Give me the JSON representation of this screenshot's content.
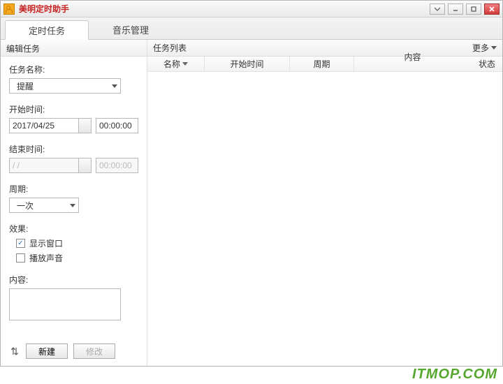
{
  "titlebar": {
    "title": "美明定时助手"
  },
  "tabs": {
    "timer": "定时任务",
    "music": "音乐管理"
  },
  "left": {
    "header": "编辑任务",
    "task_name_label": "任务名称:",
    "task_name_value": "提醒",
    "start_time_label": "开始时间:",
    "start_date_value": "2017/04/25",
    "start_time_value": "00:00:00",
    "end_time_label": "结束时间:",
    "end_date_value": "/   /",
    "end_time_value": "00:00:00",
    "period_label": "周期:",
    "period_value": "一次",
    "effect_label": "效果:",
    "show_window_label": "显示窗口",
    "play_sound_label": "播放声音",
    "content_label": "内容:",
    "content_value": "",
    "btn_new": "新建",
    "btn_edit": "修改"
  },
  "right": {
    "header": "任务列表",
    "more": "更多",
    "cols": {
      "name": "名称",
      "start": "开始时间",
      "period": "周期",
      "content": "内容",
      "status": "状态"
    }
  },
  "watermark": "ITMOP.COM"
}
